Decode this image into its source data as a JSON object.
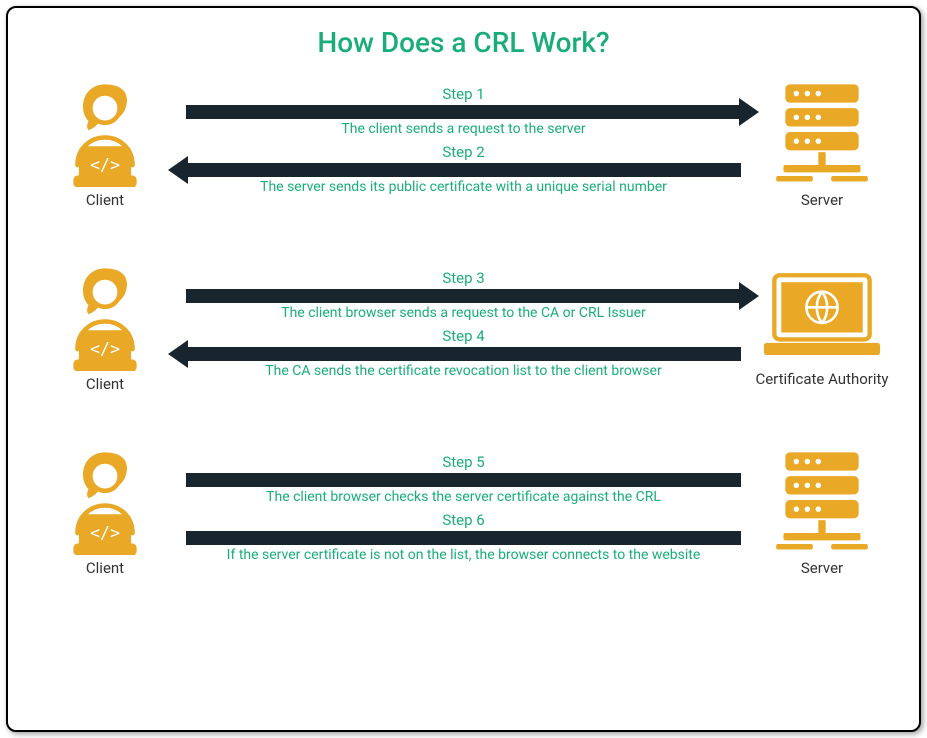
{
  "title": "How Does a CRL Work?",
  "rows": [
    {
      "leftLabel": "Client",
      "rightLabel": "Server",
      "steps": [
        {
          "label": "Step 1",
          "desc": "The client sends a request to the server",
          "dir": "right"
        },
        {
          "label": "Step 2",
          "desc": "The server sends its public certificate with a unique serial number",
          "dir": "left"
        }
      ]
    },
    {
      "leftLabel": "Client",
      "rightLabel": "Certificate Authority",
      "steps": [
        {
          "label": "Step 3",
          "desc": "The client browser sends a request to the CA or CRL Issuer",
          "dir": "right"
        },
        {
          "label": "Step 4",
          "desc": "The CA sends the certificate revocation list to the client browser",
          "dir": "left"
        }
      ]
    },
    {
      "leftLabel": "Client",
      "rightLabel": "Server",
      "steps": [
        {
          "label": "Step 5",
          "desc": "The client browser checks the server certificate against the CRL",
          "dir": "none"
        },
        {
          "label": "Step 6",
          "desc": "If the server certificate is not on the list, the browser connects to the website",
          "dir": "none"
        }
      ]
    }
  ],
  "colors": {
    "accent": "#1aad7a",
    "icon": "#e9a825",
    "arrow": "#19252e"
  }
}
